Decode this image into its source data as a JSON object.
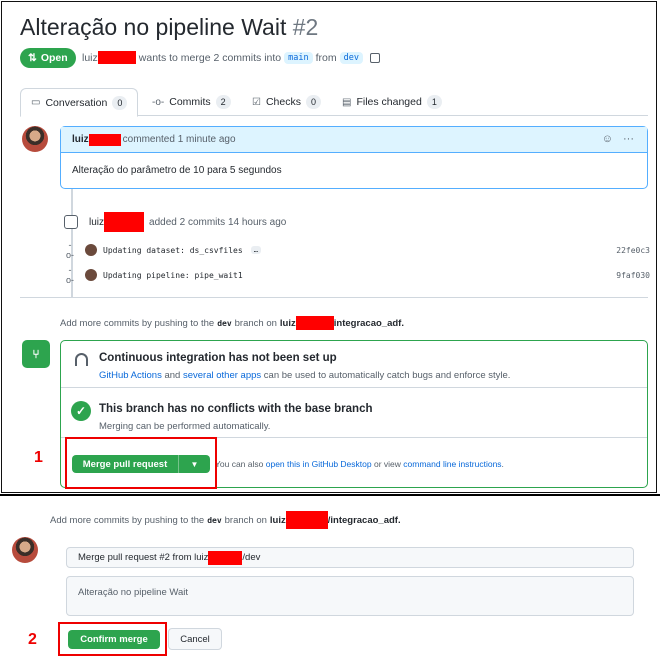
{
  "pr": {
    "title": "Alteração no pipeline Wait",
    "number": "#2",
    "state": "Open",
    "author": "luiz",
    "meta_text": "wants to merge 2 commits into",
    "base": "main",
    "from_word": "from",
    "head": "dev"
  },
  "tabs": [
    {
      "label": "Conversation",
      "count": "0"
    },
    {
      "label": "Commits",
      "count": "2"
    },
    {
      "label": "Checks",
      "count": "0"
    },
    {
      "label": "Files changed",
      "count": "1"
    }
  ],
  "comment": {
    "author": "luiz",
    "time": "commented 1 minute ago",
    "body": "Alteração do parâmetro de 10 para 5 segundos"
  },
  "commits": {
    "author": "luiz",
    "summary": "added 2 commits 14 hours ago",
    "items": [
      {
        "message": "Updating dataset: ds_csvfiles",
        "sha": "22fe0c3",
        "more": "…"
      },
      {
        "message": "Updating pipeline: pipe_wait1",
        "sha": "9faf030"
      }
    ]
  },
  "hint1": {
    "pre": "Add more commits by pushing to the",
    "branch": "dev",
    "mid": "branch on",
    "repo_prefix": "luiz",
    "repo_suffix": "integracao_adf."
  },
  "merge": {
    "ci_title": "Continuous integration has not been set up",
    "ci_link1": "GitHub Actions",
    "ci_and": "and",
    "ci_link2": "several other apps",
    "ci_rest": "can be used to automatically catch bugs and enforce style.",
    "nc_title": "This branch has no conflicts with the base branch",
    "nc_sub": "Merging can be performed automatically.",
    "button": "Merge pull request",
    "foot_pre": "You can also",
    "foot_link1": "open this in GitHub Desktop",
    "foot_or": "or view",
    "foot_link2": "command line instructions",
    "foot_end": "."
  },
  "hint2": {
    "pre": "Add more commits by pushing to the",
    "branch": "dev",
    "mid": "branch on",
    "repo_prefix": "luiz",
    "repo_suffix": "/integracao_adf."
  },
  "confirm": {
    "title_prefix": "Merge pull request #2 from luiz",
    "title_suffix": "/dev",
    "message": "Alteração no pipeline Wait",
    "confirm_label": "Confirm merge",
    "cancel_label": "Cancel"
  },
  "annotations": {
    "step1": "1",
    "step2": "2"
  },
  "colors": {
    "green": "#2da44e",
    "blue": "#0969da",
    "annotation": "#e00000",
    "redaction": "#ff0000"
  }
}
